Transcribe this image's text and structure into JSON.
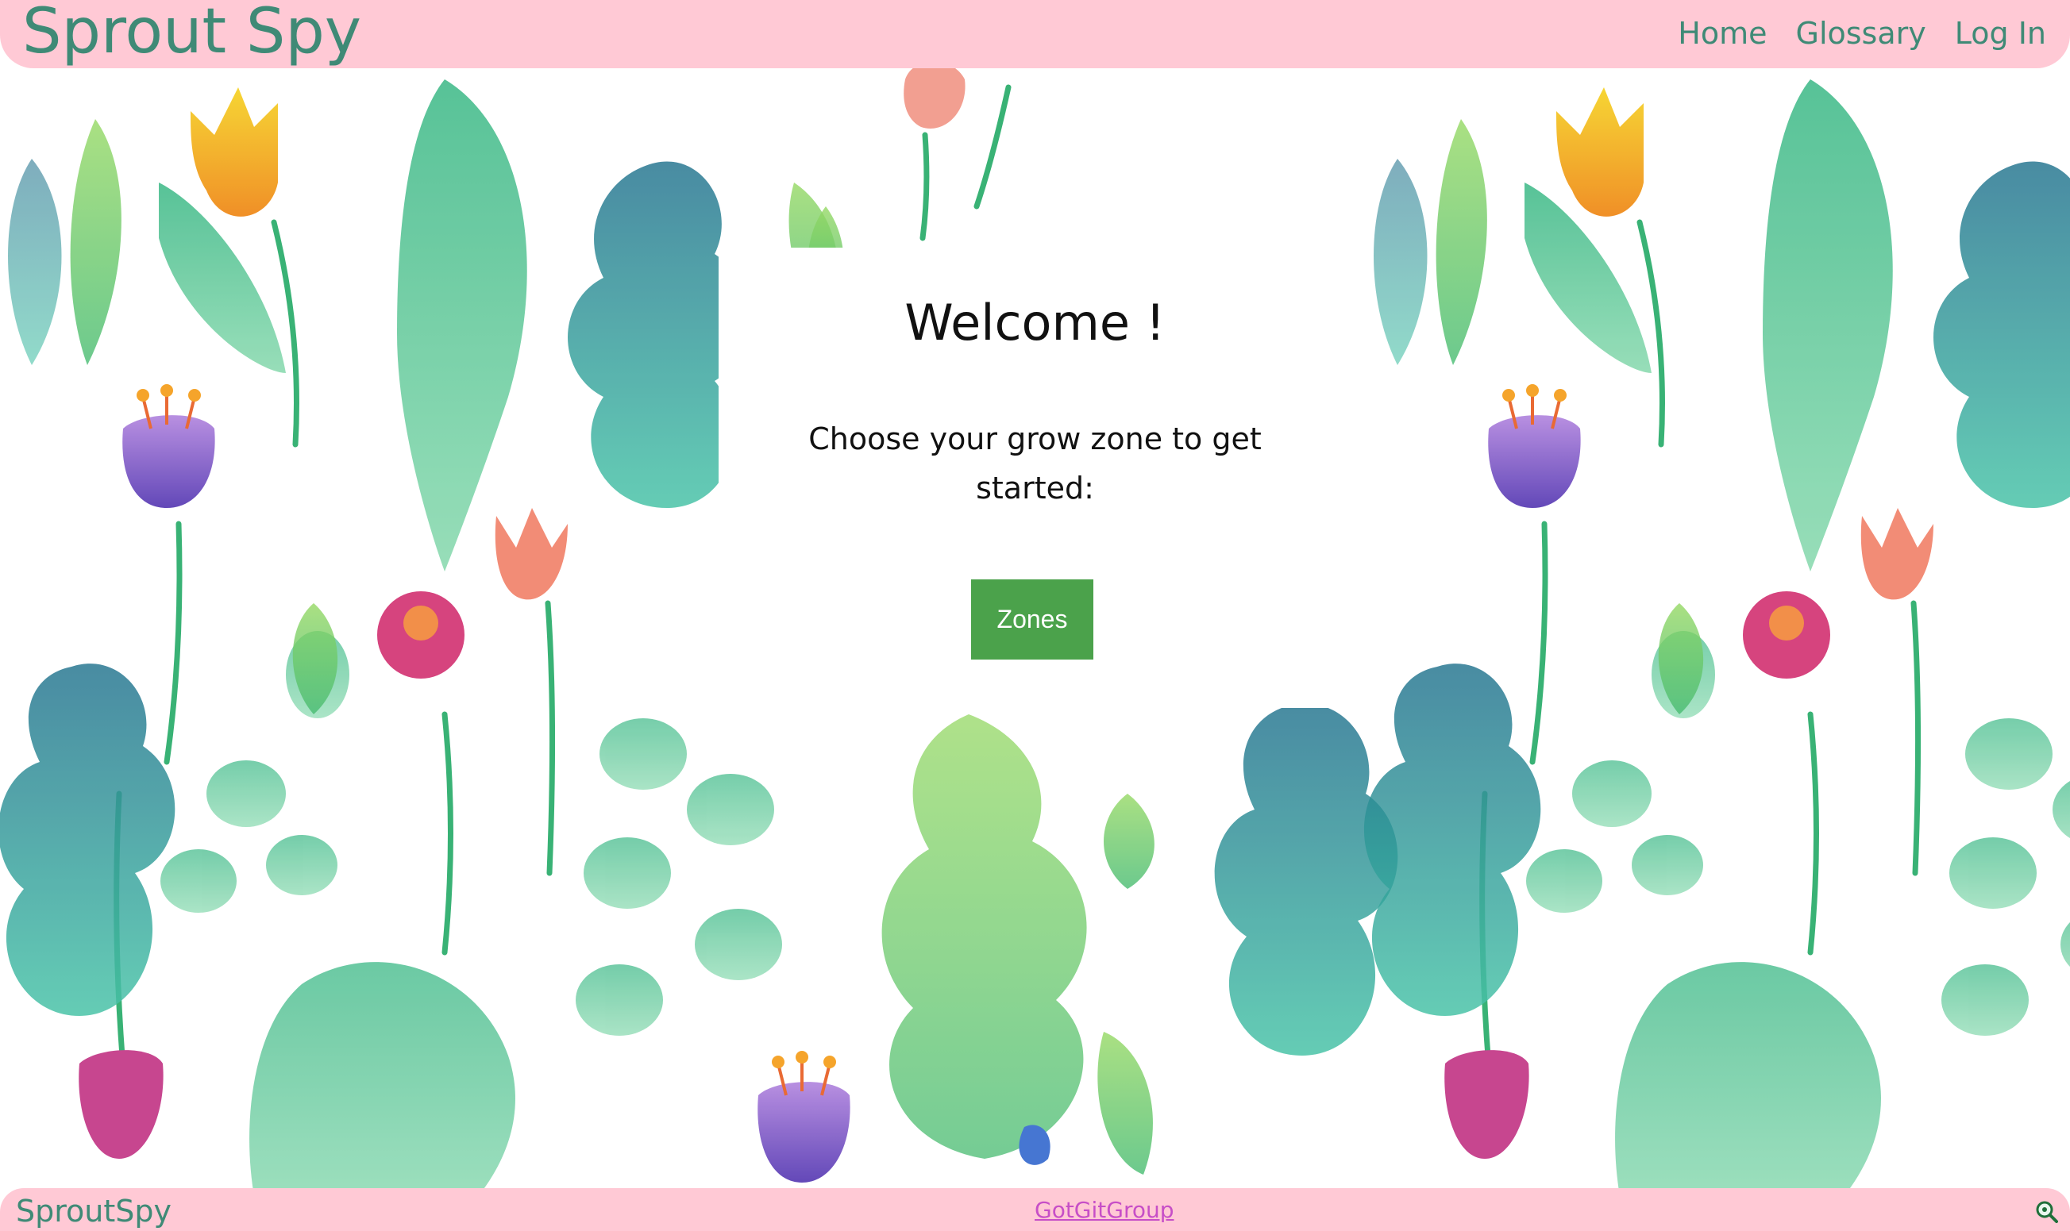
{
  "header": {
    "brand": "Sprout Spy",
    "nav": {
      "home": "Home",
      "glossary": "Glossary",
      "login": "Log In"
    }
  },
  "welcome": {
    "title": "Welcome !",
    "subtitle": "Choose your grow zone to get started:",
    "button_label": "Zones"
  },
  "footer": {
    "brand": "SproutSpy",
    "link": "GotGitGroup",
    "icon": "magnifier-icon"
  },
  "colors": {
    "header_bg": "#ffc9d5",
    "brand_text": "#3f8a76",
    "button_bg": "#4ba24b",
    "footer_link": "#c74fc7"
  }
}
